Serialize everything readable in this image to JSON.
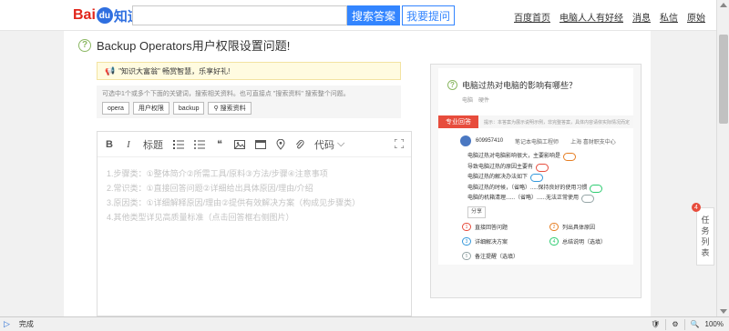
{
  "header": {
    "logo_part1": "Bai",
    "logo_part2": "du",
    "logo_part3": "知道",
    "search_placeholder": "",
    "search_button": "搜索答案",
    "ask_button": "我要提问",
    "links": [
      "百度首页",
      "电脑人人有好经",
      "消息",
      "私信",
      "原始"
    ]
  },
  "question": {
    "title": "Backup Operators用户权限设置问题!"
  },
  "notice": {
    "text": "\"知识大富翁\" 畅赏智慧，乐享好礼!"
  },
  "hint": {
    "text": "可选中1个或多个下面的关键词，搜索相关资料。也可直接点 \"搜索资料\" 搜索整个问题。",
    "tags": [
      "opera",
      "用户权限",
      "backup"
    ],
    "search_tag": "搜索资料"
  },
  "editor": {
    "toolbar": {
      "bold": "B",
      "italic": "I",
      "heading": "标题",
      "quote": "❝",
      "code": "代码"
    },
    "placeholder_lines": [
      "1.步骤类：①整体简介②所需工具/原料③方法/步骤④注意事项",
      "2.常识类：①直接回答问题②详细给出具体原因/理由/介绍",
      "3.原因类：①详细解释原因/理由②提供有效解决方案（构成见步骤类）",
      "4.其他类型详见高质量标准（点击回答框右侧图片）"
    ]
  },
  "sidebar": {
    "sample_question": "电脑过热对电脑的影响有哪些？",
    "meta": [
      "电脑",
      "硬件"
    ],
    "pro_label": "专业回答",
    "pro_tip": "提示：本答案为展示说明示例，非完整答案，具体内容请依实际情况而定",
    "user_name": "609957410",
    "user_title": "笔记本电脑工程师",
    "user_loc": "上海 喜财职支中心",
    "answer_lines": [
      "电脑过热对电脑影响很大，主要影响是",
      "导致电脑过热的原因主要有",
      "电脑过热的解决办法如下",
      "电脑过热的时候，（省略）.....保持良好的使用习惯",
      "电脑的机箱清理......（省略）......无法正常使用"
    ],
    "share": "分享",
    "legend": [
      "直接回答问题",
      "列出具体原因",
      "详细解决方案",
      "总结说明（选填）",
      "备注提醒（选填）"
    ]
  },
  "float": {
    "badge": "4",
    "label_chars": [
      "任",
      "务",
      "列",
      "表"
    ]
  },
  "statusbar": {
    "status": "完成",
    "zoom": "100%"
  },
  "colors": {
    "accent": "#3385ff",
    "brand_red": "#e1251b",
    "pro_red": "#e74c3c"
  }
}
